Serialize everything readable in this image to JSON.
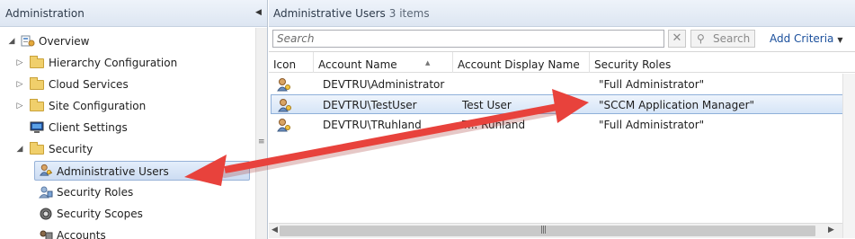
{
  "nav": {
    "title": "Administration",
    "collapse_icon": "chevron-left-icon",
    "tree": [
      {
        "label": "Overview",
        "icon": "overview-icon",
        "twisty": "◢"
      },
      {
        "label": "Hierarchy Configuration",
        "icon": "folder-icon",
        "twisty": "▷"
      },
      {
        "label": "Cloud Services",
        "icon": "folder-icon",
        "twisty": "▷"
      },
      {
        "label": "Site Configuration",
        "icon": "folder-icon",
        "twisty": "▷"
      },
      {
        "label": "Client Settings",
        "icon": "monitor-icon",
        "twisty": ""
      },
      {
        "label": "Security",
        "icon": "folder-icon",
        "twisty": "◢"
      },
      {
        "label": "Administrative Users",
        "icon": "admin-user-icon",
        "selected": true
      },
      {
        "label": "Security Roles",
        "icon": "security-roles-icon"
      },
      {
        "label": "Security Scopes",
        "icon": "security-scope-icon"
      },
      {
        "label": "Accounts",
        "icon": "accounts-icon"
      }
    ]
  },
  "content": {
    "title": "Administrative Users",
    "count": "3 items",
    "search": {
      "placeholder": "Search",
      "clear_icon": "close-icon",
      "button_label": "Search",
      "button_icon": "search-icon",
      "add_criteria": "Add Criteria"
    },
    "columns": [
      "Icon",
      "Account Name",
      "Account Display Name",
      "Security Roles"
    ],
    "rows": [
      {
        "icon": "admin-user-icon",
        "account_name": "DEVTRU\\Administrator",
        "display_name": "",
        "roles": "\"Full Administrator\""
      },
      {
        "icon": "admin-user-icon",
        "account_name": "DEVTRU\\TestUser",
        "display_name": "Test User",
        "roles": "\"SCCM Application Manager\"",
        "selected": true
      },
      {
        "icon": "admin-user-icon",
        "account_name": "DEVTRU\\TRuhland",
        "display_name": "T... Ruhland",
        "roles": "\"Full Administrator\""
      }
    ]
  },
  "colors": {
    "annotation_arrow": "#e8423c",
    "selection": "#cfe0f5",
    "link": "#1a4f9c"
  }
}
